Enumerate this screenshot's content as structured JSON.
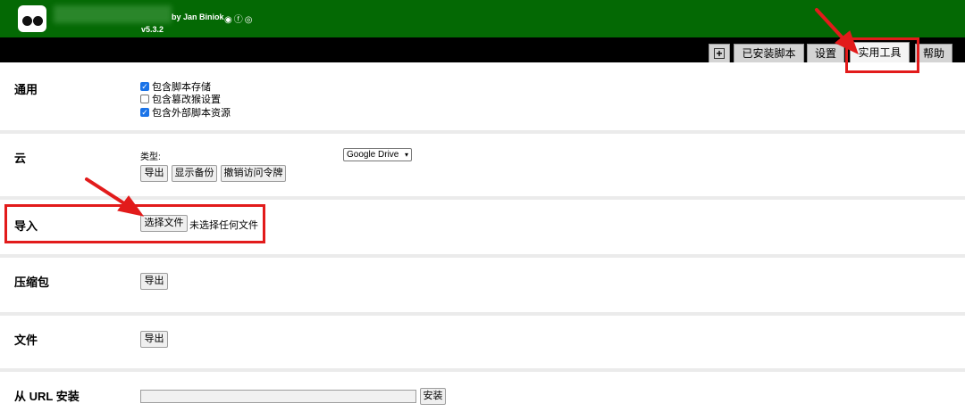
{
  "header": {
    "byline": "by Jan Biniok",
    "social_icons": [
      "github-icon",
      "facebook-icon",
      "instagram-icon"
    ],
    "version": "v5.3.2"
  },
  "tabs": {
    "add_icon": "plus-box-icon",
    "items": [
      {
        "label": "已安装脚本",
        "active": false
      },
      {
        "label": "设置",
        "active": false
      },
      {
        "label": "实用工具",
        "active": true
      },
      {
        "label": "帮助",
        "active": false
      }
    ]
  },
  "general": {
    "label": "通用",
    "options": [
      {
        "label": "包含脚本存储",
        "checked": true
      },
      {
        "label": "包含篡改猴设置",
        "checked": false
      },
      {
        "label": "包含外部脚本资源",
        "checked": true
      }
    ]
  },
  "cloud": {
    "label": "云",
    "type_label": "类型:",
    "type_value": "Google Drive",
    "buttons": [
      "导出",
      "显示备份",
      "撤销访问令牌"
    ]
  },
  "import": {
    "label": "导入",
    "choose_button": "选择文件",
    "no_file_text": "未选择任何文件"
  },
  "zip": {
    "label": "压缩包",
    "export_button": "导出"
  },
  "file": {
    "label": "文件",
    "export_button": "导出"
  },
  "url_install": {
    "label": "从 URL 安装",
    "input_value": "",
    "install_button": "安装"
  },
  "colors": {
    "header_green": "#046904",
    "annotation_red": "#e21b1b",
    "checkbox_blue": "#1a73e8"
  }
}
